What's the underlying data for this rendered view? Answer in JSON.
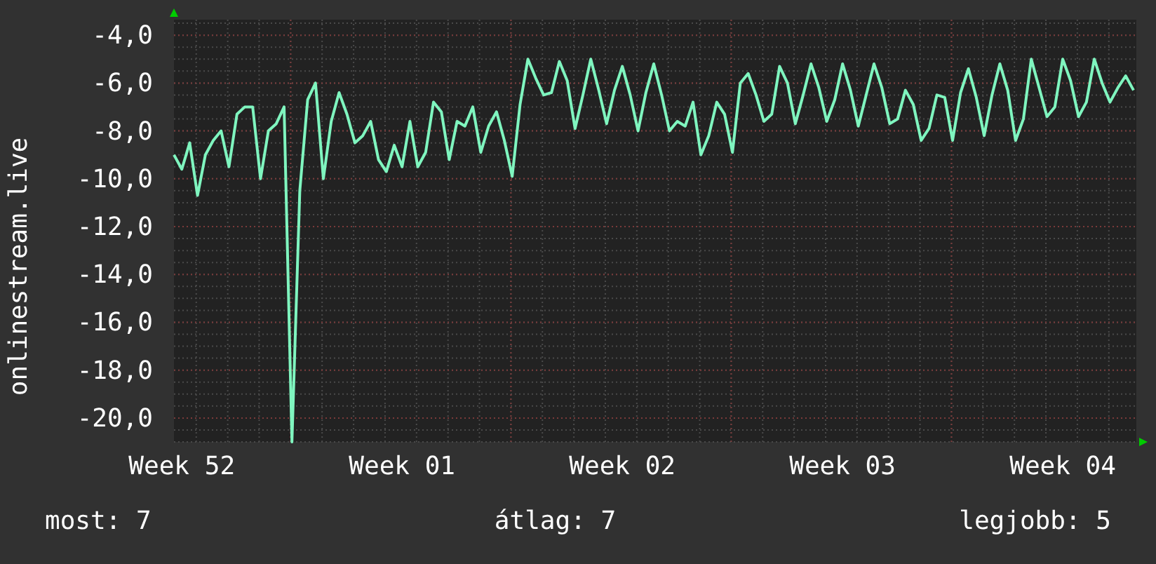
{
  "graph": {
    "ylabel": "onlinestream.live",
    "chart_data": {
      "type": "line",
      "grid": true,
      "ylim": [
        -21,
        -3.35
      ],
      "yticks": [
        {
          "value": -4,
          "label": "-4,0"
        },
        {
          "value": -6,
          "label": "-6,0"
        },
        {
          "value": -8,
          "label": "-8,0"
        },
        {
          "value": -10,
          "label": "-10,0"
        },
        {
          "value": -12,
          "label": "-12,0"
        },
        {
          "value": -14,
          "label": "-14,0"
        },
        {
          "value": -16,
          "label": "-16,0"
        },
        {
          "value": -18,
          "label": "-18,0"
        },
        {
          "value": -20,
          "label": "-20,0"
        }
      ],
      "categories": [
        null,
        "Week 52",
        null,
        null,
        null,
        null,
        null,
        null,
        null,
        null,
        null,
        null,
        null,
        null,
        null,
        null,
        null,
        null,
        null,
        null,
        null,
        null,
        null,
        null,
        null,
        null,
        null,
        null,
        null,
        "Week 01",
        null,
        null,
        null,
        null,
        null,
        null,
        null,
        null,
        null,
        null,
        null,
        null,
        null,
        null,
        null,
        null,
        null,
        null,
        null,
        null,
        null,
        null,
        null,
        null,
        null,
        null,
        null,
        "Week 02",
        null,
        null,
        null,
        null,
        null,
        null,
        null,
        null,
        null,
        null,
        null,
        null,
        null,
        null,
        null,
        null,
        null,
        null,
        null,
        null,
        null,
        null,
        null,
        null,
        null,
        null,
        null,
        "Week 03",
        null,
        null,
        null,
        null,
        null,
        null,
        null,
        null,
        null,
        null,
        null,
        null,
        null,
        null,
        null,
        null,
        null,
        null,
        null,
        null,
        null,
        null,
        null,
        null,
        null,
        null,
        null,
        "Week 04",
        null,
        null,
        null,
        null,
        null,
        null,
        null,
        null,
        null
      ],
      "series": [
        {
          "color": "#7ff5bf",
          "values": [
            -9,
            -9.6,
            -8.5,
            -10.7,
            -9,
            -8.4,
            -8,
            -9.5,
            -7.3,
            -7,
            -7,
            -10,
            -8,
            -7.7,
            -7,
            -21,
            -10.5,
            -6.7,
            -6,
            -10,
            -7.6,
            -6.4,
            -7.3,
            -8.5,
            -8.2,
            -7.6,
            -9.2,
            -9.7,
            -8.6,
            -9.5,
            -7.6,
            -9.5,
            -8.9,
            -6.8,
            -7.2,
            -9.2,
            -7.6,
            -7.8,
            -7,
            -8.9,
            -7.8,
            -7.2,
            -8.4,
            -9.9,
            -6.9,
            -5,
            -5.8,
            -6.5,
            -6.4,
            -5.1,
            -5.9,
            -7.9,
            -6.5,
            -5,
            -6.3,
            -7.7,
            -6.3,
            -5.3,
            -6.5,
            -8,
            -6.4,
            -5.2,
            -6.5,
            -8,
            -7.6,
            -7.8,
            -6.8,
            -9,
            -8.2,
            -6.8,
            -7.3,
            -8.9,
            -6,
            -5.6,
            -6.5,
            -7.6,
            -7.3,
            -5.3,
            -6,
            -7.7,
            -6.5,
            -5.2,
            -6.2,
            -7.6,
            -6.7,
            -5.2,
            -6.3,
            -7.8,
            -6.5,
            -5.2,
            -6.2,
            -7.7,
            -7.5,
            -6.3,
            -6.9,
            -8.4,
            -7.9,
            -6.5,
            -6.6,
            -8.4,
            -6.4,
            -5.4,
            -6.6,
            -8.2,
            -6.5,
            -5.2,
            -6.3,
            -8.4,
            -7.5,
            -5,
            -6.2,
            -7.4,
            -7,
            -5,
            -5.9,
            -7.4,
            -6.8,
            -5,
            -6,
            -6.8,
            -6.2,
            -5.7,
            -6.3
          ]
        }
      ]
    }
  },
  "legend": [
    {
      "text": "most: 7"
    },
    {
      "text": "átlag: 7"
    },
    {
      "text": "legjobb: 5"
    }
  ]
}
